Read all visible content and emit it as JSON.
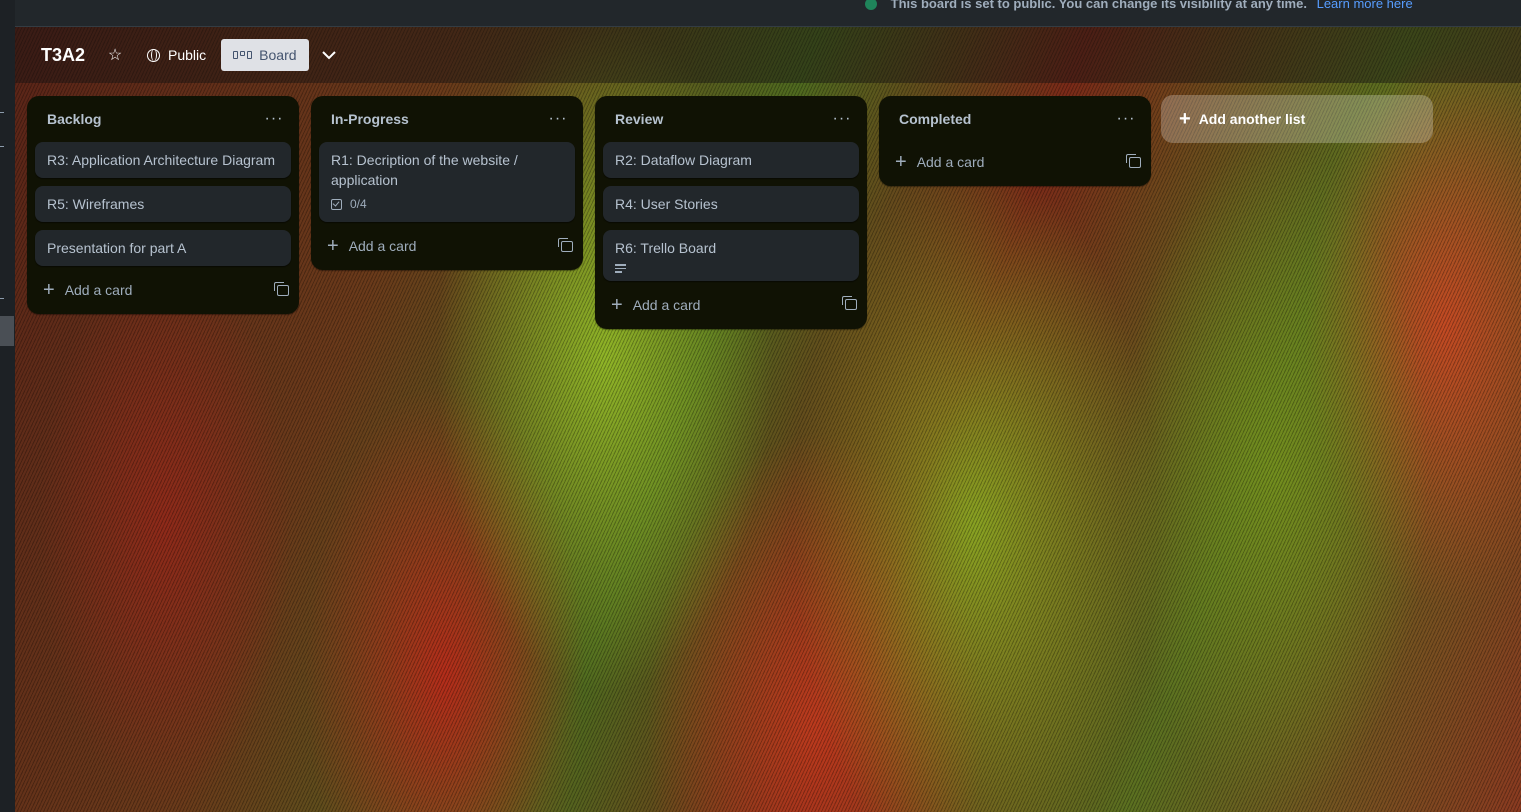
{
  "banner": {
    "message": "This board is set to public. You can change its visibility at any time.",
    "link": "Learn more here"
  },
  "header": {
    "title": "T3A2",
    "visibility": "Public",
    "view": "Board"
  },
  "lists": [
    {
      "title": "Backlog",
      "cards": [
        {
          "title": "R3: Application Architecture Diagram"
        },
        {
          "title": "R5: Wireframes"
        },
        {
          "title": "Presentation for part A"
        }
      ],
      "add_card": "Add a card"
    },
    {
      "title": "In-Progress",
      "cards": [
        {
          "title": "R1: Decription of the website / application",
          "checklist": "0/4"
        }
      ],
      "add_card": "Add a card"
    },
    {
      "title": "Review",
      "cards": [
        {
          "title": "R2: Dataflow Diagram"
        },
        {
          "title": "R4: User Stories"
        },
        {
          "title": "R6: Trello Board",
          "has_description": true
        }
      ],
      "add_card": "Add a card"
    },
    {
      "title": "Completed",
      "cards": [],
      "add_card": "Add a card"
    }
  ],
  "add_list": "Add another list",
  "icons": {
    "star": "star-icon",
    "visibility": "globe-icon",
    "board": "board-icon",
    "chevron": "chevron-down-icon",
    "menu": "ellipsis-icon",
    "add": "plus-icon",
    "template": "template-icon",
    "checklist": "checklist-icon",
    "description": "description-icon"
  },
  "colors": {
    "list_bg": "#101204",
    "card_bg": "#22272b",
    "link": "#579dff"
  }
}
